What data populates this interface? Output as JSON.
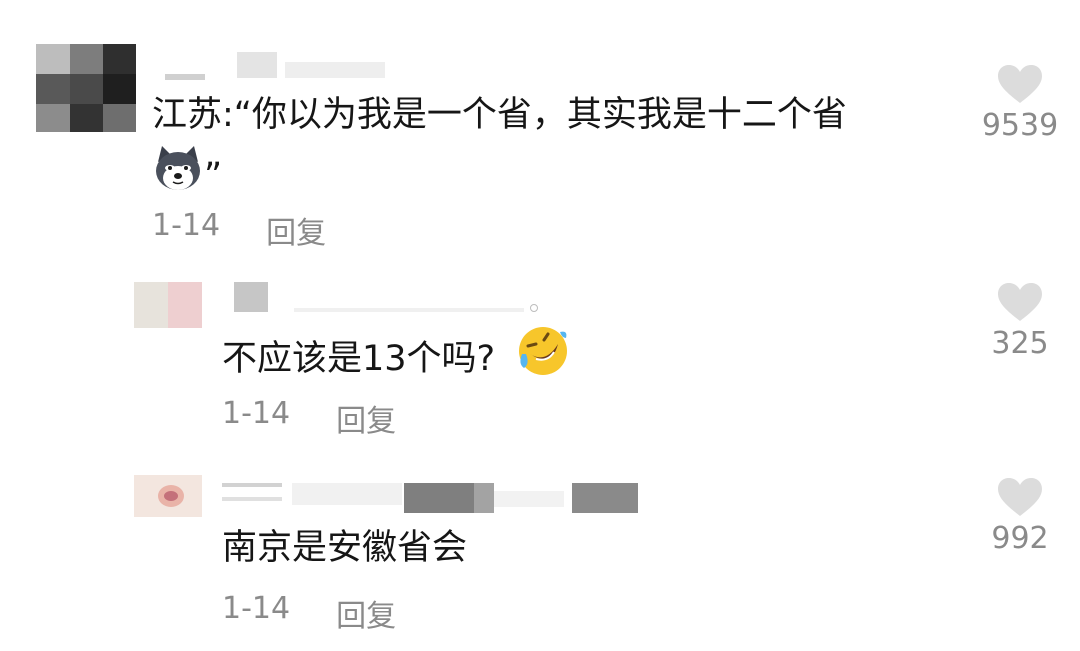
{
  "comments": [
    {
      "text_before_emoji": "江苏:“你以为我是一个省，其实我是十二个省",
      "text_after_emoji": "”",
      "emoji_icon": "dog-face-emoji",
      "date": "1-14",
      "reply_label": "回复",
      "likes": "9539"
    },
    {
      "text": "不应该是13个吗?",
      "emoji_icon": "rolling-laughing-emoji",
      "date": "1-14",
      "reply_label": "回复",
      "likes": "325"
    },
    {
      "text": "南京是安徽省会",
      "date": "1-14",
      "reply_label": "回复",
      "likes": "992"
    }
  ],
  "colors": {
    "heart": "#dcdcdc",
    "meta_text": "#8a8a8a"
  },
  "icons": {
    "like": "heart-icon"
  }
}
